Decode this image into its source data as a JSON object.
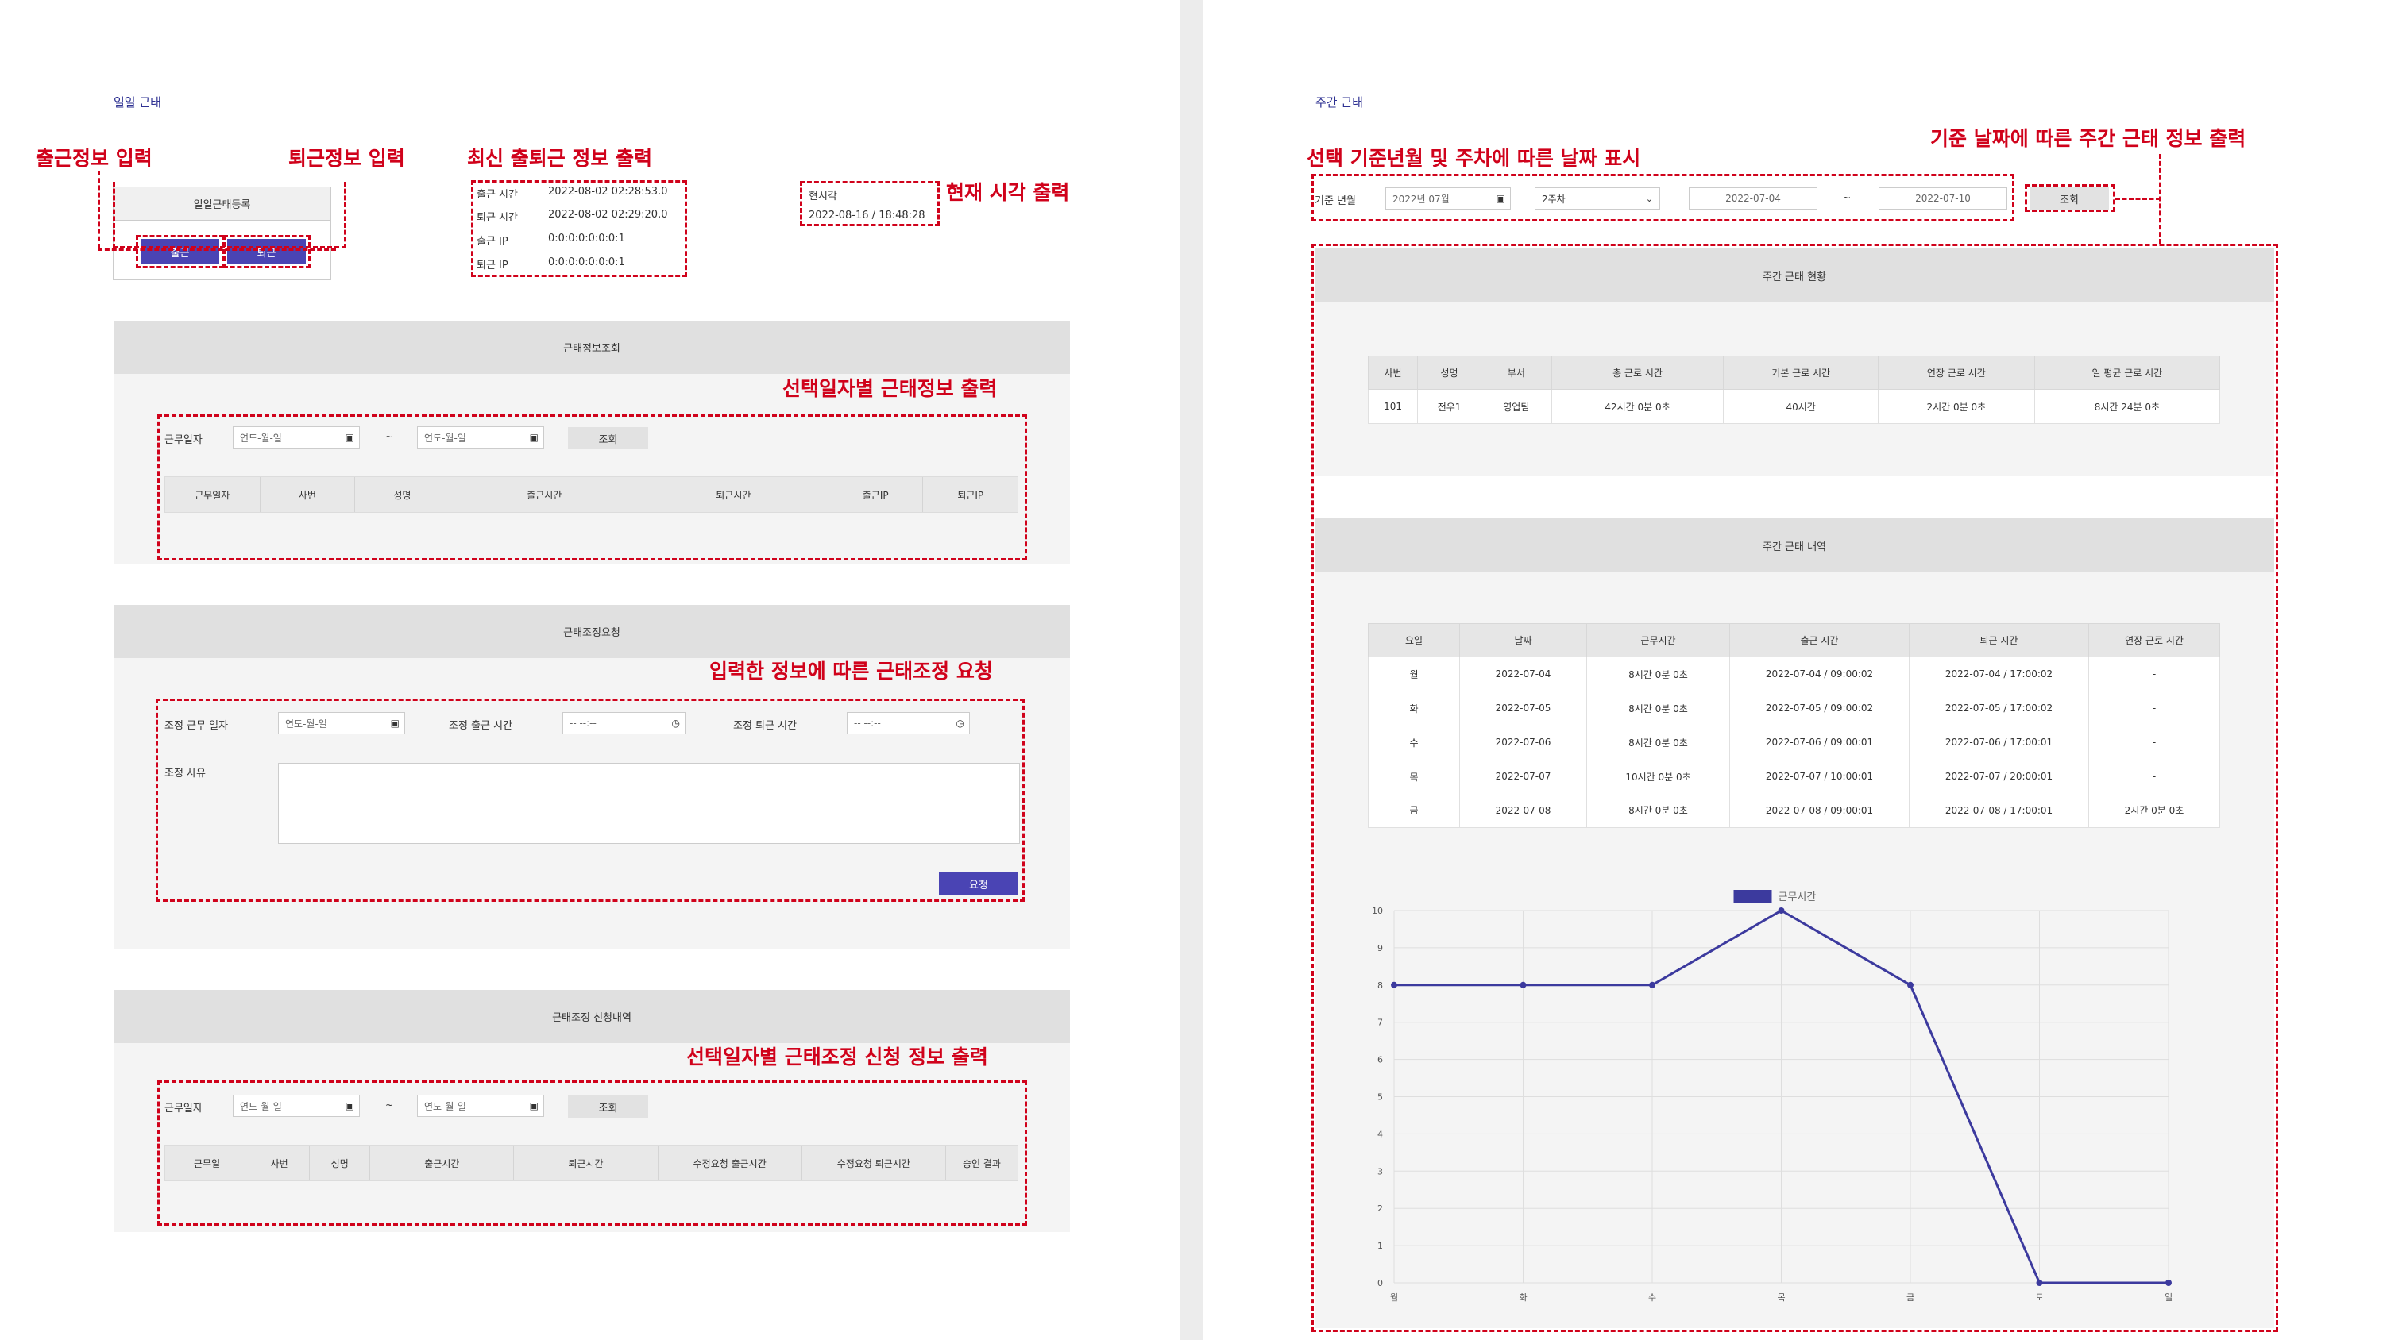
{
  "daily": {
    "title": "일일 근태",
    "annotations": {
      "clock_in": "출근정보 입력",
      "clock_out": "퇴근정보 입력",
      "latest": "최신 출퇴근 정보 출력",
      "now": "현재 시각 출력",
      "attendance_by_date": "선택일자별 근태정보 출력",
      "adjust_request": "입력한 정보에 따른 근태조정 요청",
      "adjust_list": "선택일자별 근태조정 신청 정보 출력"
    },
    "register": {
      "title": "일일근태등록",
      "clock_in_btn": "출근",
      "clock_out_btn": "퇴근"
    },
    "latest": {
      "rows": [
        {
          "label": "출근 시간",
          "value": "2022-08-02 02:28:53.0"
        },
        {
          "label": "퇴근 시간",
          "value": "2022-08-02 02:29:20.0"
        },
        {
          "label": "출근 IP",
          "value": "0:0:0:0:0:0:0:1"
        },
        {
          "label": "퇴근 IP",
          "value": "0:0:0:0:0:0:0:1"
        }
      ]
    },
    "now": {
      "label": "현시각",
      "value": "2022-08-16 / 18:48:28"
    },
    "inquiry": {
      "title": "근태정보조회",
      "date_label": "근무일자",
      "date_placeholder": "연도-월-일",
      "tilde": "~",
      "search_btn": "조회",
      "columns": [
        "근무일자",
        "사번",
        "성명",
        "출근시간",
        "퇴근시간",
        "출근IP",
        "퇴근IP"
      ]
    },
    "adjust": {
      "title": "근태조정요청",
      "date_label": "조정 근무 일자",
      "date_placeholder": "연도-월-일",
      "in_label": "조정 출근 시간",
      "out_label": "조정 퇴근 시간",
      "time_placeholder": "-- --:--",
      "reason_label": "조정 사유",
      "request_btn": "요청"
    },
    "adjust_list": {
      "title": "근태조정 신청내역",
      "date_label": "근무일자",
      "date_placeholder": "연도-월-일",
      "tilde": "~",
      "search_btn": "조회",
      "columns": [
        "근무일",
        "사번",
        "성명",
        "출근시간",
        "퇴근시간",
        "수정요청 출근시간",
        "수정요청 퇴근시간",
        "승인 결과"
      ]
    }
  },
  "weekly": {
    "title": "주간 근태",
    "annotations": {
      "date_display": "선택 기준년월 및 주차에 따른 날짜 표시",
      "weekly_output": "기준 날짜에 따른 주간 근태 정보 출력"
    },
    "filter": {
      "label": "기준 년월",
      "month_value": "2022년 07월",
      "week_value": "2주차",
      "start": "2022-07-04",
      "tilde": "~",
      "end": "2022-07-10",
      "search_btn": "조회"
    },
    "status": {
      "title": "주간 근태 현황",
      "columns": [
        "사번",
        "성명",
        "부서",
        "총 근로 시간",
        "기본 근로 시간",
        "연장 근로 시간",
        "일 평균 근로 시간"
      ],
      "row": [
        "101",
        "전우1",
        "영업팀",
        "42시간 0분 0초",
        "40시간",
        "2시간 0분 0초",
        "8시간 24분 0초"
      ]
    },
    "detail": {
      "title": "주간 근태 내역",
      "columns": [
        "요일",
        "날짜",
        "근무시간",
        "출근 시간",
        "퇴근 시간",
        "연장 근로 시간"
      ],
      "rows": [
        [
          "월",
          "2022-07-04",
          "8시간 0분 0초",
          "2022-07-04 / 09:00:02",
          "2022-07-04 / 17:00:02",
          "-"
        ],
        [
          "화",
          "2022-07-05",
          "8시간 0분 0초",
          "2022-07-05 / 09:00:02",
          "2022-07-05 / 17:00:02",
          "-"
        ],
        [
          "수",
          "2022-07-06",
          "8시간 0분 0초",
          "2022-07-06 / 09:00:01",
          "2022-07-06 / 17:00:01",
          "-"
        ],
        [
          "목",
          "2022-07-07",
          "10시간 0분 0초",
          "2022-07-07 / 10:00:01",
          "2022-07-07 / 20:00:01",
          "-"
        ],
        [
          "금",
          "2022-07-08",
          "8시간 0분 0초",
          "2022-07-08 / 09:00:01",
          "2022-07-08 / 17:00:01",
          "2시간 0분 0초"
        ]
      ]
    }
  },
  "chart_data": {
    "type": "line",
    "categories": [
      "월",
      "화",
      "수",
      "목",
      "금",
      "토",
      "일"
    ],
    "series": [
      {
        "name": "근무시간",
        "values": [
          8,
          8,
          8,
          10,
          8,
          0,
          0
        ],
        "color": "#3c3a9e"
      }
    ],
    "ylim": [
      0,
      10
    ],
    "yticks": [
      "0",
      "1",
      "2",
      "3",
      "4",
      "5",
      "6",
      "7",
      "8",
      "9",
      "10"
    ],
    "grid": true,
    "legend": "top-center"
  },
  "colors": {
    "accent": "#4a44b4",
    "annotation": "#d0021b",
    "title": "#2e3192"
  }
}
